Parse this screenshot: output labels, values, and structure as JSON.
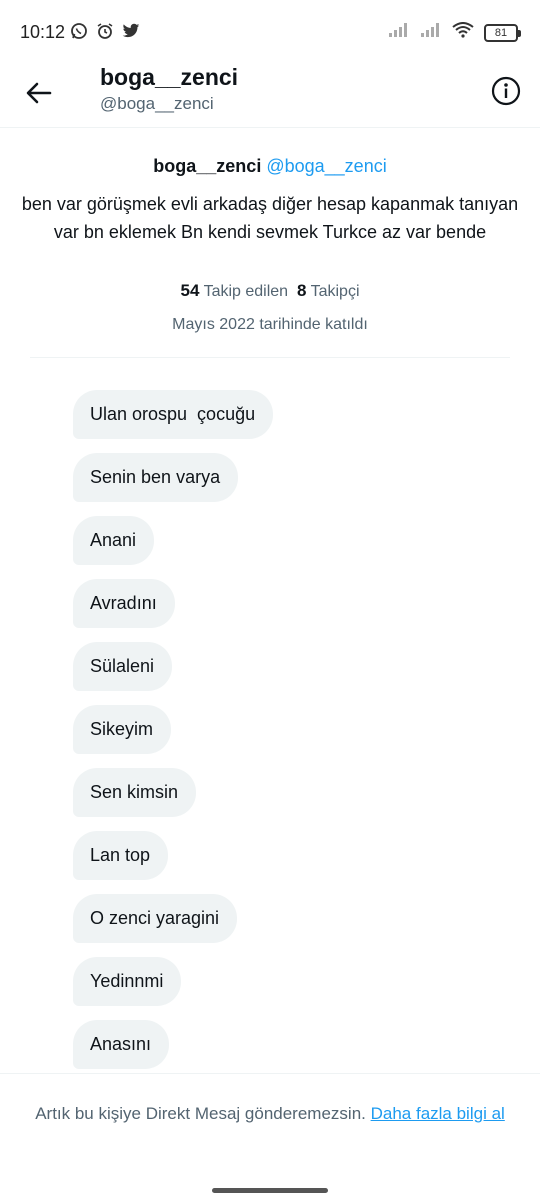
{
  "status_bar": {
    "time": "10:12",
    "battery": "81",
    "icons": [
      "whatsapp-icon",
      "alarm-icon",
      "twitter-icon",
      "signal-icon",
      "signal-icon",
      "wifi-icon",
      "battery-icon"
    ]
  },
  "header": {
    "name": "boga__zenci",
    "handle": "@boga__zenci",
    "back_icon": "arrow-left-icon",
    "info_icon": "info-icon"
  },
  "profile": {
    "name": "boga__zenci",
    "handle": "@boga__zenci",
    "bio": "ben var görüşmek evli arkadaş diğer hesap kapanmak tanıyan var bn eklemek Bn  kendi  sevmek Turkce az var bende",
    "following_count": "54",
    "following_label": "Takip edilen",
    "followers_count": "8",
    "followers_label": "Takipçi",
    "joined": "Mayıs 2022 tarihinde katıldı"
  },
  "messages": [
    "Ulan orospu  çocuğu",
    "Senin ben varya",
    "Anani",
    "Avradını",
    "Sülaleni",
    "Sikeyim",
    "Sen kimsin",
    "Lan top",
    "O zenci yaragini",
    "Yedinnmi",
    "Anasını"
  ],
  "footer": {
    "text": "Artık bu kişiye Direkt Mesaj gönderemezsin.",
    "link": "Daha fazla bilgi al"
  },
  "colors": {
    "accent": "#1d9bf0",
    "bubble_bg": "#eff3f4",
    "secondary_text": "#536471"
  }
}
